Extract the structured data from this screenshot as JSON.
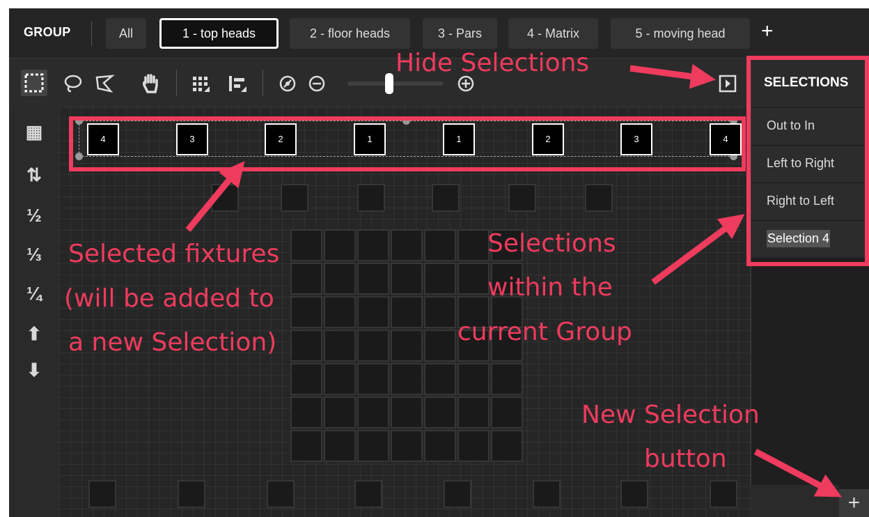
{
  "group_bar": {
    "label": "GROUP",
    "tabs": [
      {
        "label": "All",
        "active": false
      },
      {
        "label": "1 - top heads",
        "active": true
      },
      {
        "label": "2 - floor heads",
        "active": false
      },
      {
        "label": "3 - Pars",
        "active": false
      },
      {
        "label": "4 - Matrix",
        "active": false
      },
      {
        "label": "5 - moving head",
        "active": false
      }
    ],
    "add_label": "+"
  },
  "toolbar": {
    "icons": [
      "rectangle-select-icon",
      "lasso-select-icon",
      "polygon-select-icon",
      "hand-pan-icon",
      "grid-snap-icon",
      "align-icon",
      "zoom-reset-icon",
      "zoom-out-icon",
      "zoom-slider",
      "zoom-in-icon",
      "hide-selections-icon"
    ]
  },
  "left_rail": {
    "items": [
      {
        "icon": "grid-layout-icon",
        "text": "▦"
      },
      {
        "icon": "swap-order-icon",
        "text": "⇅"
      },
      {
        "icon": "half-icon",
        "text": "½"
      },
      {
        "icon": "third-icon",
        "text": "⅓"
      },
      {
        "icon": "quarter-icon",
        "text": "¼"
      },
      {
        "icon": "arrow-up-icon",
        "text": "⬆"
      },
      {
        "icon": "arrow-down-icon",
        "text": "⬇"
      }
    ]
  },
  "canvas": {
    "selected_fixtures": [
      "4",
      "3",
      "2",
      "1",
      "1",
      "2",
      "3",
      "4"
    ]
  },
  "selections": {
    "title": "SELECTIONS",
    "items": [
      {
        "label": "Out to In",
        "selected": false
      },
      {
        "label": "Left to Right",
        "selected": false
      },
      {
        "label": "Right to Left",
        "selected": false
      },
      {
        "label": "Selection 4",
        "selected": true
      }
    ],
    "add_label": "+"
  },
  "annotations": {
    "hide_selections": "Hide Selections",
    "selected_fixtures": [
      "Selected fixtures",
      "(will be added to",
      "a new Selection)"
    ],
    "selections_within": [
      "Selections",
      "within the",
      "current Group"
    ],
    "new_selection": [
      "New Selection",
      "button"
    ]
  },
  "colors": {
    "annotation": "#ef3b5d",
    "background": "#1e1e1e",
    "panel": "#2b2b2b"
  }
}
